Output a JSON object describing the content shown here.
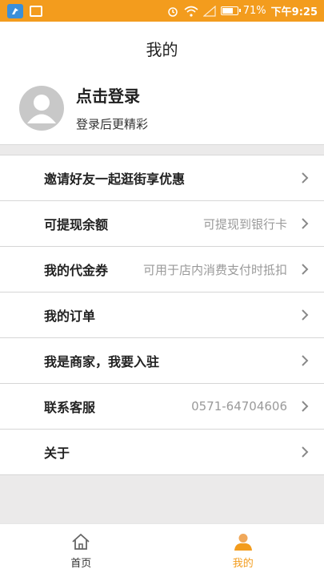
{
  "status_bar": {
    "battery_text": "71%",
    "battery_level": 0.71,
    "time": "下午9:25",
    "accent_color": "#f39c1d"
  },
  "header": {
    "title": "我的"
  },
  "profile": {
    "login_title": "点击登录",
    "login_subtitle": "登录后更精彩"
  },
  "menu": {
    "items": [
      {
        "label": "邀请好友一起逛街享优惠",
        "hint": ""
      },
      {
        "label": "可提现余额",
        "hint": "可提现到银行卡"
      },
      {
        "label": "我的代金券",
        "hint": "可用于店内消费支付时抵扣"
      },
      {
        "label": "我的订单",
        "hint": ""
      },
      {
        "label": "我是商家，我要入驻",
        "hint": ""
      },
      {
        "label": "联系客服",
        "hint": "0571-64704606"
      },
      {
        "label": "关于",
        "hint": ""
      }
    ]
  },
  "tabbar": {
    "home_label": "首页",
    "mine_label": "我的",
    "active_tab": "我的"
  }
}
